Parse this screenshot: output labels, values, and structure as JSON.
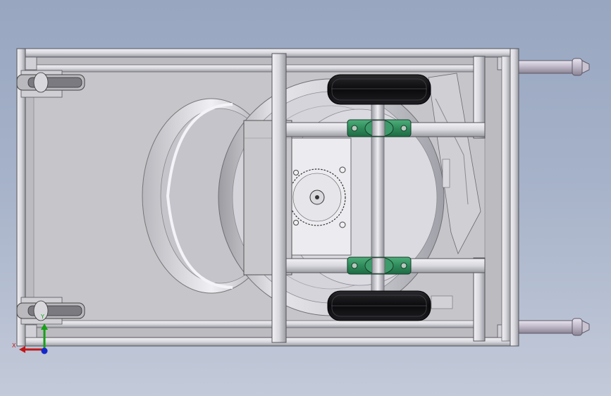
{
  "window": {
    "background_top": "#98a6c0",
    "background_bottom": "#c3cad9"
  },
  "model": {
    "view": "top",
    "frame_color": "#e1e1e6",
    "plate_color": "#bcbcc0",
    "tire_color": "#111111",
    "bearing_color": "#2f8a5a",
    "spool_color": "#d6d6db"
  },
  "triad": {
    "x_label": "X",
    "y_label": "Y",
    "x_color": "#c01818",
    "y_color": "#16a016",
    "z_color": "#1428c8"
  }
}
